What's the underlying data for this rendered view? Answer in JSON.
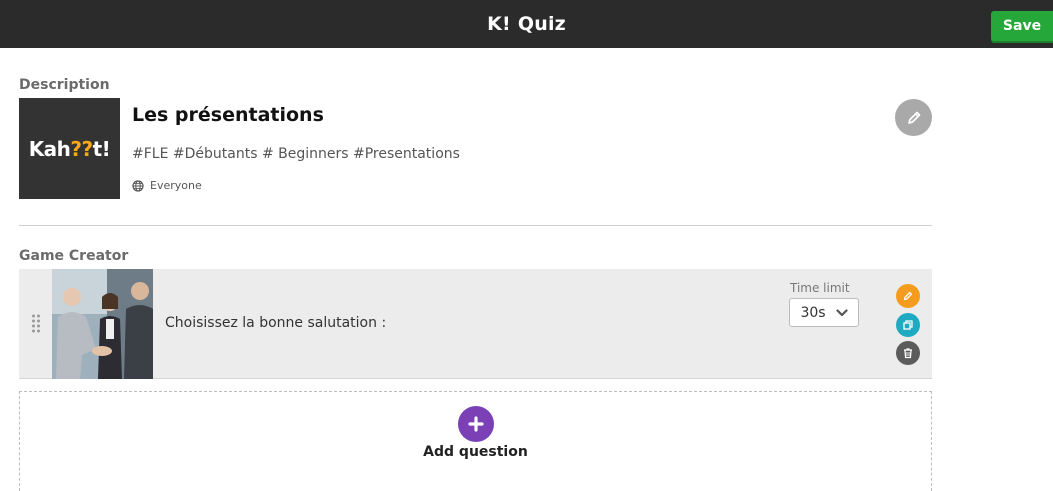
{
  "header": {
    "brand_logo": "K!",
    "title": "Quiz",
    "save_label": "Save"
  },
  "description": {
    "section_label": "Description",
    "cover_text_a": "Kah",
    "cover_text_q": "??",
    "cover_text_b": "t!",
    "title": "Les présentations",
    "tags": "#FLE #Débutants # Beginners #Presentations",
    "visibility_icon": "globe-icon",
    "visibility": "Everyone",
    "edit_icon": "pencil-icon"
  },
  "game_creator": {
    "section_label": "Game Creator",
    "questions": [
      {
        "text": "Choisissez la bonne salutation :",
        "time_limit_label": "Time limit",
        "time_limit_value": "30s"
      }
    ],
    "add_label": "Add question"
  },
  "colors": {
    "topbar": "#2b2b2b",
    "save": "#26a73a",
    "edit": "#f59c1e",
    "duplicate": "#1eaac0",
    "delete": "#5c5c5c",
    "add": "#7b3fb6"
  }
}
